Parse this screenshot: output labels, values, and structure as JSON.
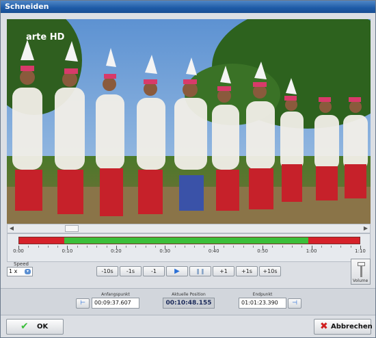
{
  "window": {
    "title": "Schneiden"
  },
  "video": {
    "channel_logo": "arte HD"
  },
  "timeline": {
    "ticks": [
      "0:00",
      "0:10",
      "0:20",
      "0:30",
      "0:40",
      "0:50",
      "1:00",
      "1:10"
    ],
    "selection_start_fraction": 0.133,
    "selection_end_fraction": 0.849
  },
  "controls": {
    "speed_label": "Speed",
    "speed_value": "1 x",
    "buttons": [
      "-10s",
      "-1s",
      "-1",
      "+1",
      "+1s",
      "+10s"
    ],
    "volume_label": "Volume"
  },
  "cut": {
    "start_label": "Anfangspunkt",
    "start_value": "00:09:37.607",
    "current_label": "Aktuelle Position",
    "current_value": "00:10:48.155",
    "end_label": "Endpunkt",
    "end_value": "01:01:23.390"
  },
  "footer": {
    "ok": "OK",
    "cancel": "Abbrechen"
  },
  "colors": {
    "selection": "#3bbf3a",
    "excluded": "#d6212a",
    "titlebar": "#1d5aa6"
  }
}
